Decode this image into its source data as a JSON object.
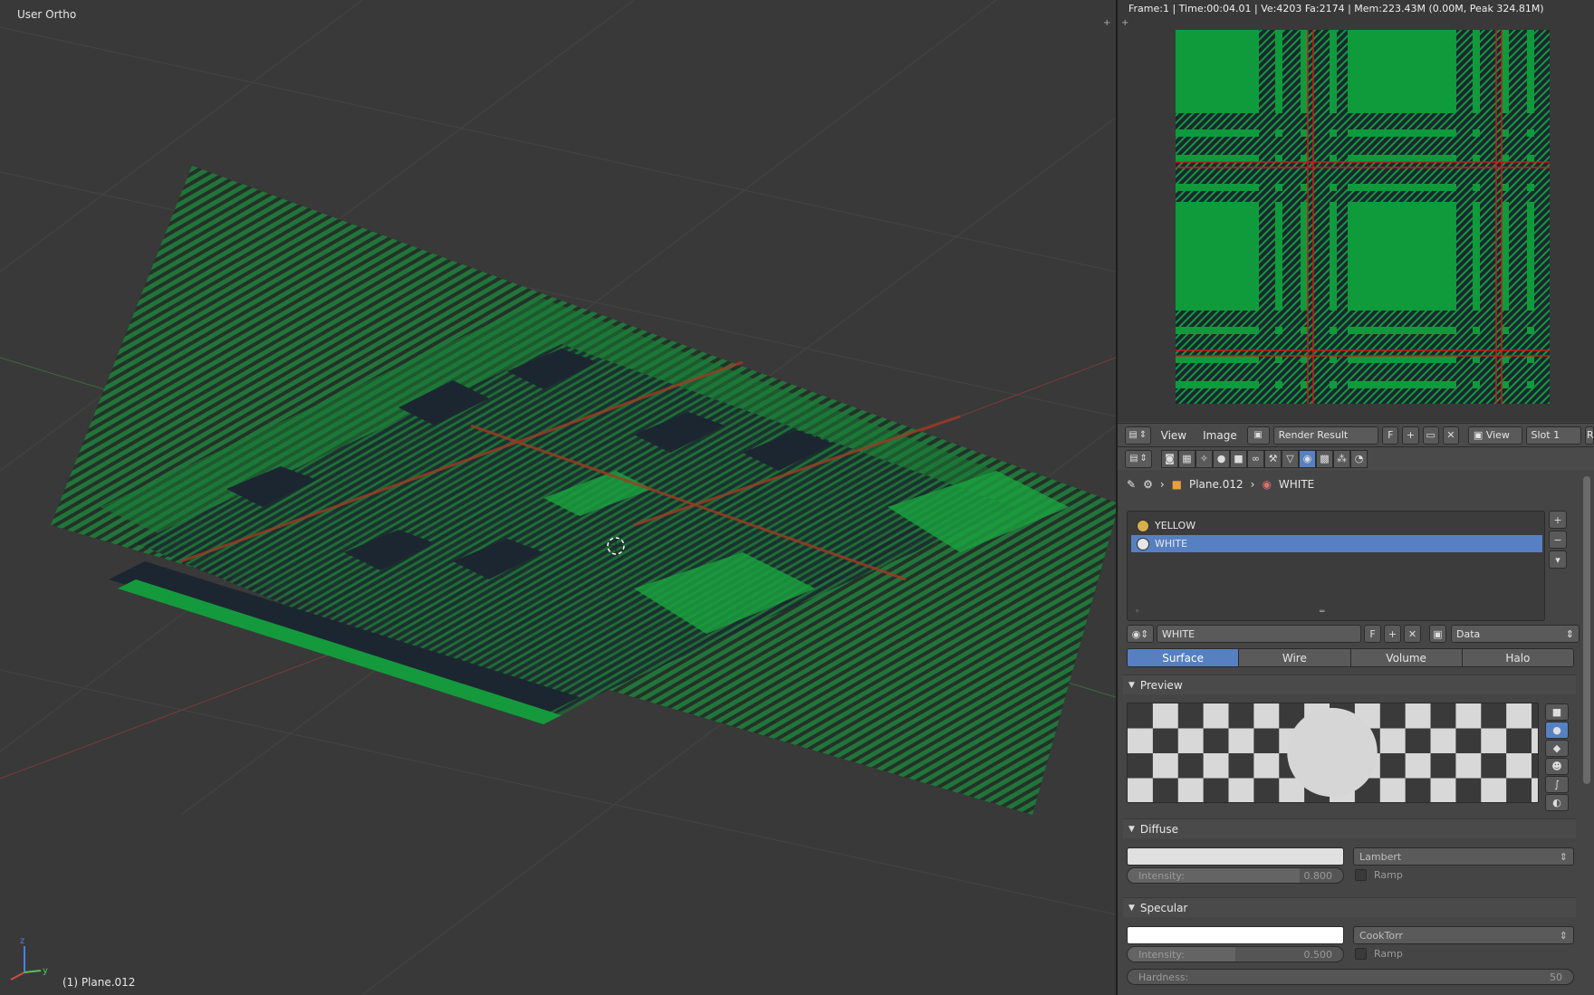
{
  "viewport": {
    "title": "User Ortho",
    "object_label": "(1) Plane.012"
  },
  "render": {
    "info": "Frame:1 | Time:00:04.01 | Ve:4203 Fa:2174 | Mem:223.43M (0.00M, Peak 324.81M)"
  },
  "image_header": {
    "menu_view": "View",
    "menu_image": "Image",
    "image_name": "Render Result",
    "fake_user": "F",
    "view_select": "View",
    "slot_select": "Slot 1",
    "clipped": "R"
  },
  "breadcrumb": {
    "object": "Plane.012",
    "material": "WHITE"
  },
  "materials": [
    {
      "name": "YELLOW",
      "color": "#d4b24a"
    },
    {
      "name": "WHITE",
      "color": "#e6e6e6"
    }
  ],
  "material_name": "WHITE",
  "material_f": "F",
  "link_select": "Data",
  "tabs": [
    "Surface",
    "Wire",
    "Volume",
    "Halo"
  ],
  "panels": {
    "preview": "Preview",
    "diffuse": "Diffuse",
    "specular": "Specular"
  },
  "diffuse": {
    "shader": "Lambert",
    "intensity_label": "Intensity:",
    "intensity_value": "0.800",
    "ramp": "Ramp",
    "intensity_fraction": 0.8
  },
  "specular": {
    "shader": "CookTorr",
    "intensity_label": "Intensity:",
    "intensity_value": "0.500",
    "ramp": "Ramp",
    "intensity_fraction": 0.5,
    "hardness_label": "Hardness:",
    "hardness_value": "50"
  },
  "colors": {
    "accent": "#5680c2",
    "tartan_green": "#0f9b3b",
    "tartan_dark": "#1c2630",
    "tartan_red": "#d01818",
    "diffuse_color": "#e0e0e0",
    "specular_color": "#ffffff"
  }
}
